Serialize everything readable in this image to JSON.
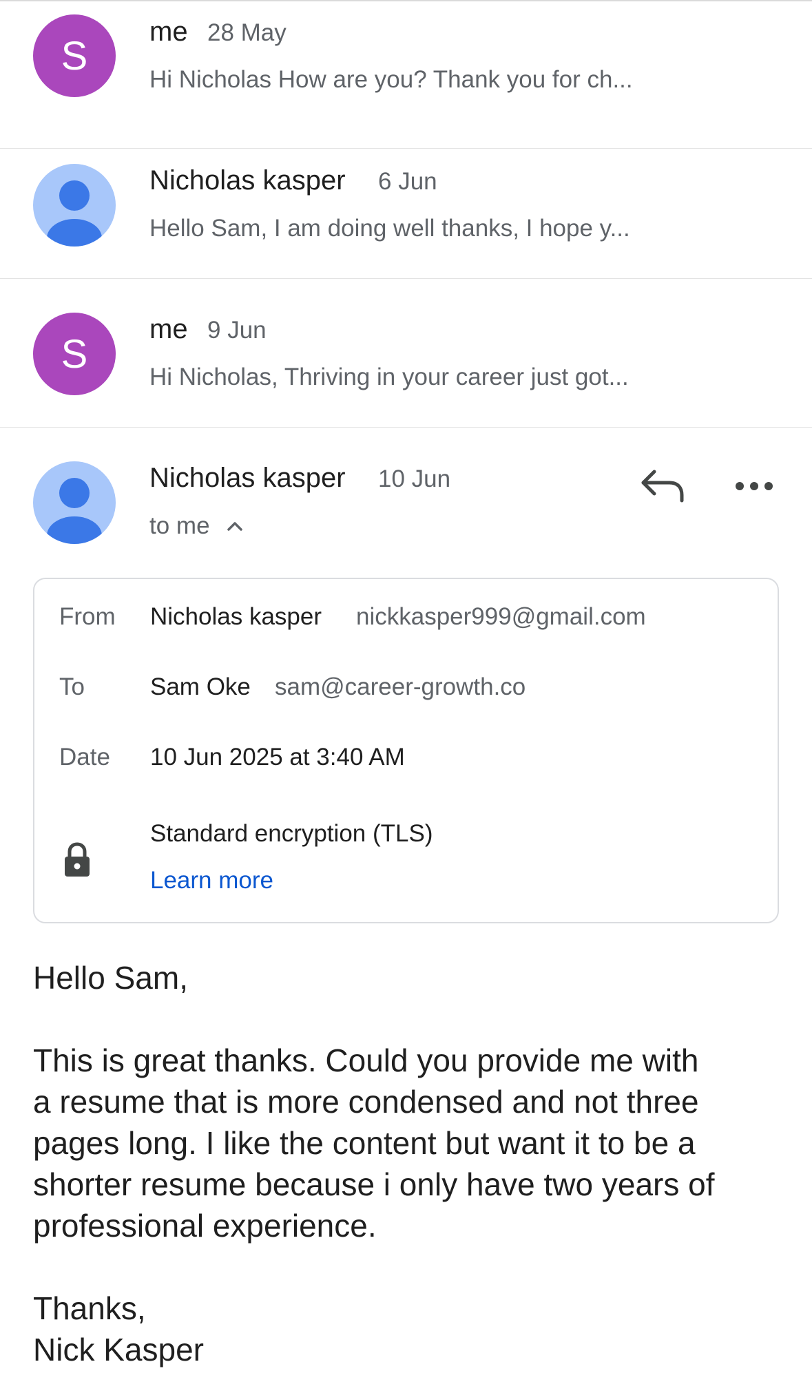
{
  "colors": {
    "avatar_me": "#aa47bc",
    "avatar_person_bg": "#a8c7fa",
    "avatar_person_fg": "#3b78e7",
    "link": "#0b57d0",
    "muted_text": "#5f6368"
  },
  "thread": [
    {
      "sender": "me",
      "avatar_letter": "S",
      "avatar_type": "letter",
      "date": "28 May",
      "snippet": "Hi Nicholas How are you? Thank you for ch..."
    },
    {
      "sender": "Nicholas kasper",
      "avatar_type": "person-icon",
      "date": "6 Jun",
      "snippet": "Hello Sam, I am doing well thanks, I hope y..."
    },
    {
      "sender": "me",
      "avatar_letter": "S",
      "avatar_type": "letter",
      "date": "9 Jun",
      "snippet": "Hi Nicholas, Thriving in your career just got..."
    }
  ],
  "open_message": {
    "sender": "Nicholas kasper",
    "avatar_type": "person-icon",
    "date": "10 Jun",
    "recipient_summary": "to me",
    "actions": [
      "reply-icon",
      "more-icon"
    ],
    "details": {
      "from_label": "From",
      "from_name": "Nicholas kasper",
      "from_email": "nickkasper999@gmail.com",
      "to_label": "To",
      "to_name": "Sam Oke",
      "to_email": "sam@career-growth.co",
      "date_label": "Date",
      "date_value": "10 Jun 2025 at 3:40 AM",
      "encryption": "Standard encryption (TLS)",
      "learn_more": "Learn more",
      "security_icon": "lock-icon"
    },
    "body": {
      "greeting": "Hello Sam,",
      "paragraph_lines": [
        "This is great thanks. Could you provide me with",
        "a resume that is more condensed and not three",
        "pages long. I like the content but want it to be a",
        "shorter resume because i only have two years of",
        "professional experience."
      ],
      "signoff": "Thanks,",
      "signature": "Nick Kasper"
    }
  }
}
